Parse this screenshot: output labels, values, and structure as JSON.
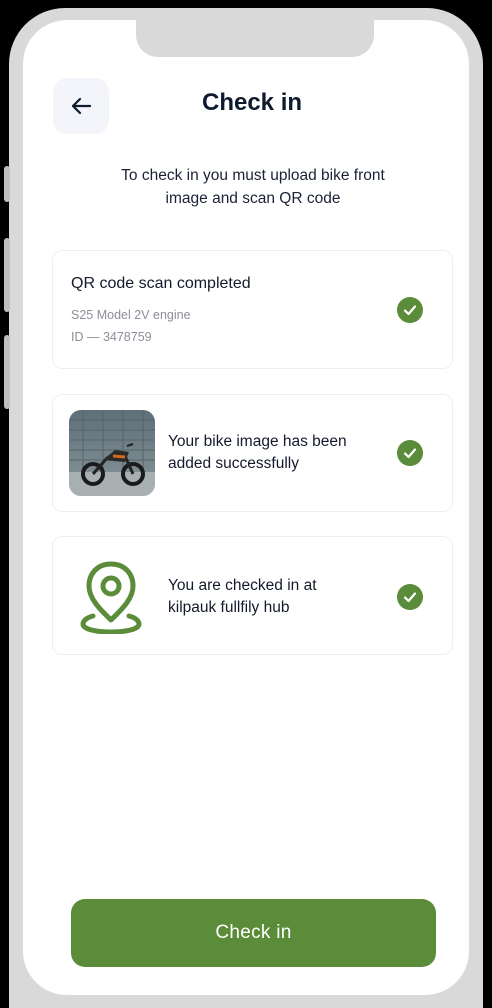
{
  "header": {
    "title": "Check in",
    "back_icon": "arrow-left-icon"
  },
  "subtitle_line1": "To check in you must upload bike front",
  "subtitle_line2": "image and scan QR code",
  "cards": [
    {
      "title": "QR code scan completed",
      "model": "S25 Model 2V engine",
      "id": "ID — 3478759",
      "status_icon": "check-circle-icon"
    },
    {
      "line1": "Your bike image has been",
      "line2": "added successfully",
      "thumbnail": "motorcycle-photo",
      "status_icon": "check-circle-icon"
    },
    {
      "line1": "You are checked in at",
      "line2": "kilpauk fullfily hub",
      "icon": "location-pin-icon",
      "status_icon": "check-circle-icon"
    }
  ],
  "button": {
    "label": "Check in"
  },
  "colors": {
    "accent_green": "#5b8c3a",
    "title_navy": "#0d1b2e",
    "back_button_bg": "#f4f4fb"
  }
}
